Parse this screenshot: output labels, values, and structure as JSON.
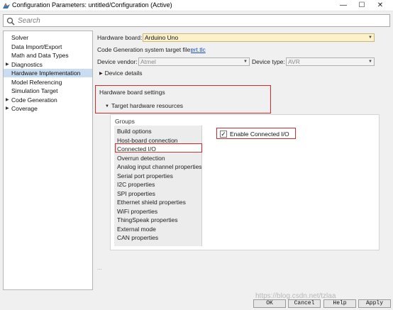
{
  "window": {
    "title": "Configuration Parameters: untitled/Configuration (Active)",
    "min_glyph": "—",
    "max_glyph": "☐",
    "close_glyph": "✕"
  },
  "search": {
    "placeholder": "Search",
    "value": ""
  },
  "nav": {
    "items": [
      {
        "label": "Solver",
        "expandable": false,
        "selected": false
      },
      {
        "label": "Data Import/Export",
        "expandable": false,
        "selected": false
      },
      {
        "label": "Math and Data Types",
        "expandable": false,
        "selected": false
      },
      {
        "label": "Diagnostics",
        "expandable": true,
        "selected": false
      },
      {
        "label": "Hardware Implementation",
        "expandable": false,
        "selected": true
      },
      {
        "label": "Model Referencing",
        "expandable": false,
        "selected": false
      },
      {
        "label": "Simulation Target",
        "expandable": false,
        "selected": false
      },
      {
        "label": "Code Generation",
        "expandable": true,
        "selected": false
      },
      {
        "label": "Coverage",
        "expandable": true,
        "selected": false
      }
    ]
  },
  "hardware": {
    "board_label": "Hardware board:",
    "board_value": "Arduino Uno",
    "codegen_label": "Code Generation system target file:",
    "codegen_link": "ert.tlc",
    "vendor_label": "Device vendor:",
    "vendor_value": "Atmel",
    "type_label": "Device type:",
    "type_value": "AVR",
    "device_details": "Device details",
    "board_settings": "Hardware board settings",
    "target_resources": "Target hardware resources",
    "groups_label": "Groups",
    "groups": [
      "Build options",
      "Host-board connection",
      "Connected I/O",
      "Overrun detection",
      "Analog input channel properties",
      "Serial port properties",
      "I2C properties",
      "SPI properties",
      "Ethernet shield properties",
      "WiFi properties",
      "ThingSpeak properties",
      "External mode",
      "CAN properties"
    ],
    "selected_group": "Connected I/O",
    "enable_connected_io_label": "Enable Connected I/O",
    "enable_connected_io_checked": true,
    "ellipsis": "..."
  },
  "buttons": {
    "ok": "OK",
    "cancel": "Cancel",
    "help": "Help",
    "apply": "Apply"
  },
  "watermark": "https://blog.csdn.net/tzlaa",
  "colors": {
    "selection": "#c8dcf2",
    "highlight_box": "#d32b2b",
    "link": "#1a4fc4",
    "active_combo": "#fdf1c9"
  }
}
